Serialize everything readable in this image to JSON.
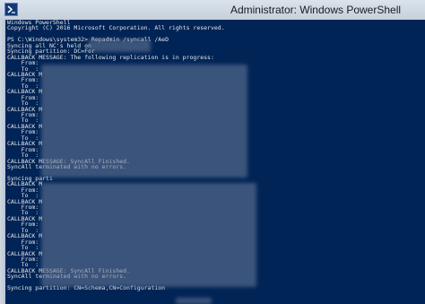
{
  "window": {
    "title": "Administrator: Windows PowerShell",
    "icon": "powershell-icon"
  },
  "console": {
    "background": "#012456",
    "foreground": "#e6e6e6",
    "lines": [
      "Windows PowerShell",
      "Copyright (C) 2016 Microsoft Corporation. All rights reserved.",
      "",
      "PS C:\\Windows\\system32> Repadmin /syncall /AeD",
      "Syncing all NC's held on",
      "Syncing partition: DC=For",
      "CALLBACK MESSAGE: The following replication is in progress:",
      "    From:",
      "    To  :",
      "CALLBACK M",
      "    From:",
      "    To  :",
      "CALLBACK M",
      "    From:",
      "    To  :",
      "CALLBACK M",
      "    From:",
      "    To  :",
      "CALLBACK M",
      "    From:",
      "    To  :",
      "CALLBACK M",
      "    From:",
      "    To  :",
      "CALLBACK MESSAGE: SyncAll Finished.",
      "SyncAll terminated with no errors.",
      "",
      "Syncing parti",
      "CALLBACK M",
      "    From:",
      "    To  :",
      "CALLBACK M",
      "    From:",
      "    To  :",
      "CALLBACK M",
      "    From:",
      "    To  :",
      "CALLBACK M",
      "    From:",
      "    To  :",
      "CALLBACK M",
      "    From:",
      "    To  :",
      "CALLBACK MESSAGE: SyncAll Finished.",
      "SyncAll terminated with no errors.",
      "",
      "Syncing partition: CN=Schema,CN=Configuration"
    ]
  }
}
